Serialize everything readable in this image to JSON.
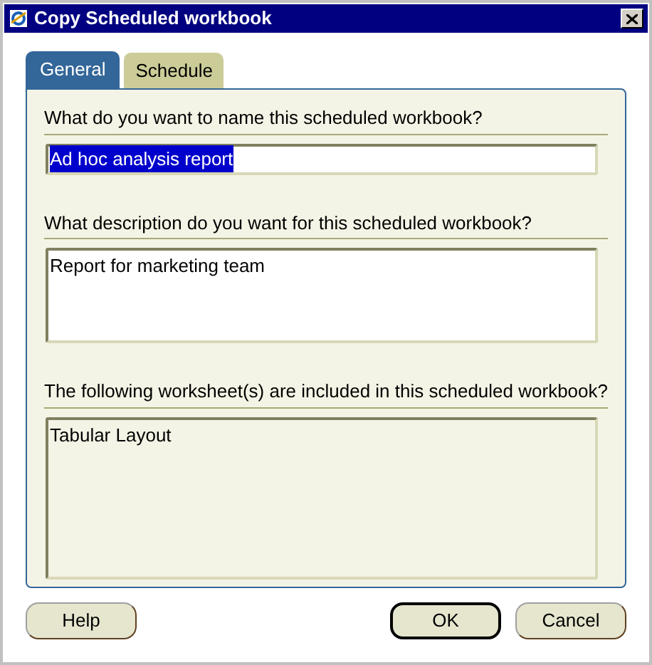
{
  "window": {
    "title": "Copy Scheduled workbook"
  },
  "tabs": [
    {
      "label": "General",
      "selected": true
    },
    {
      "label": "Schedule",
      "selected": false
    }
  ],
  "fields": [
    {
      "kind": "input",
      "label": "What do you want to name this scheduled workbook?",
      "value": "Ad hoc analysis report",
      "text_selected": true
    },
    {
      "kind": "textarea",
      "label": "What description do you want for this scheduled workbook?",
      "value": "Report for marketing team"
    },
    {
      "kind": "list",
      "label": "The following worksheet(s) are included in this scheduled workbook?",
      "items": [
        "Tabular Layout"
      ]
    }
  ],
  "buttons": [
    {
      "label": "Help",
      "default": false
    },
    {
      "label": "OK",
      "default": true
    },
    {
      "label": "Cancel",
      "default": false
    }
  ]
}
